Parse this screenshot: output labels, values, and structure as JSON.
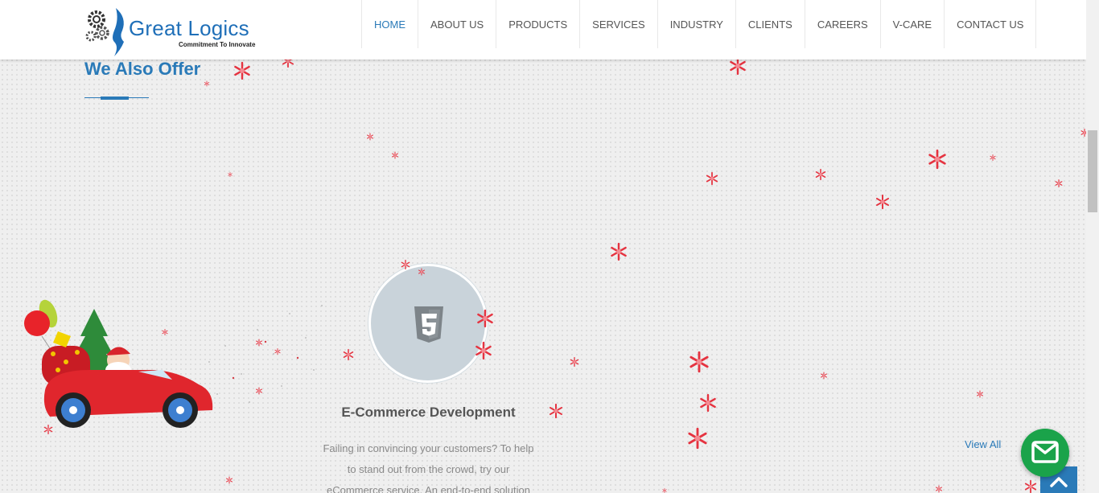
{
  "brand": {
    "name": "Great Logics",
    "tagline": "Commitment To Innovate"
  },
  "nav": {
    "items": [
      {
        "label": "HOME",
        "active": true
      },
      {
        "label": "ABOUT US"
      },
      {
        "label": "PRODUCTS"
      },
      {
        "label": "SERVICES"
      },
      {
        "label": "INDUSTRY"
      },
      {
        "label": "CLIENTS"
      },
      {
        "label": "CAREERS"
      },
      {
        "label": "V-CARE"
      },
      {
        "label": "CONTACT US"
      }
    ]
  },
  "section": {
    "title": "We Also Offer",
    "view_all": "View All"
  },
  "service": {
    "icon": "html5-icon",
    "title": "E-Commerce Development",
    "description": "Failing in convincing your customers? To help to stand out from the crowd, try our eCommerce service. An end-to-end solution"
  },
  "colors": {
    "accent": "#2a7ab8",
    "mail_button": "#1aa34a",
    "snowflake": "#e53340"
  },
  "floating": {
    "mail_icon": "envelope-icon",
    "back_to_top_icon": "chevron-up-icon"
  }
}
